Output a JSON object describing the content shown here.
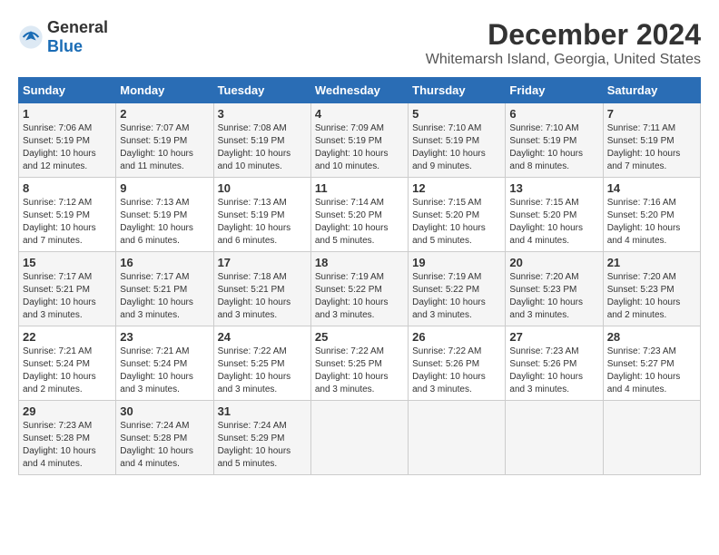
{
  "header": {
    "logo": {
      "general": "General",
      "blue": "Blue"
    },
    "title": "December 2024",
    "subtitle": "Whitemarsh Island, Georgia, United States"
  },
  "calendar": {
    "days_of_week": [
      "Sunday",
      "Monday",
      "Tuesday",
      "Wednesday",
      "Thursday",
      "Friday",
      "Saturday"
    ],
    "weeks": [
      [
        {
          "day": "1",
          "sunrise": "7:06 AM",
          "sunset": "5:19 PM",
          "daylight": "10 hours and 12 minutes."
        },
        {
          "day": "2",
          "sunrise": "7:07 AM",
          "sunset": "5:19 PM",
          "daylight": "10 hours and 11 minutes."
        },
        {
          "day": "3",
          "sunrise": "7:08 AM",
          "sunset": "5:19 PM",
          "daylight": "10 hours and 10 minutes."
        },
        {
          "day": "4",
          "sunrise": "7:09 AM",
          "sunset": "5:19 PM",
          "daylight": "10 hours and 10 minutes."
        },
        {
          "day": "5",
          "sunrise": "7:10 AM",
          "sunset": "5:19 PM",
          "daylight": "10 hours and 9 minutes."
        },
        {
          "day": "6",
          "sunrise": "7:10 AM",
          "sunset": "5:19 PM",
          "daylight": "10 hours and 8 minutes."
        },
        {
          "day": "7",
          "sunrise": "7:11 AM",
          "sunset": "5:19 PM",
          "daylight": "10 hours and 7 minutes."
        }
      ],
      [
        {
          "day": "8",
          "sunrise": "7:12 AM",
          "sunset": "5:19 PM",
          "daylight": "10 hours and 7 minutes."
        },
        {
          "day": "9",
          "sunrise": "7:13 AM",
          "sunset": "5:19 PM",
          "daylight": "10 hours and 6 minutes."
        },
        {
          "day": "10",
          "sunrise": "7:13 AM",
          "sunset": "5:19 PM",
          "daylight": "10 hours and 6 minutes."
        },
        {
          "day": "11",
          "sunrise": "7:14 AM",
          "sunset": "5:20 PM",
          "daylight": "10 hours and 5 minutes."
        },
        {
          "day": "12",
          "sunrise": "7:15 AM",
          "sunset": "5:20 PM",
          "daylight": "10 hours and 5 minutes."
        },
        {
          "day": "13",
          "sunrise": "7:15 AM",
          "sunset": "5:20 PM",
          "daylight": "10 hours and 4 minutes."
        },
        {
          "day": "14",
          "sunrise": "7:16 AM",
          "sunset": "5:20 PM",
          "daylight": "10 hours and 4 minutes."
        }
      ],
      [
        {
          "day": "15",
          "sunrise": "7:17 AM",
          "sunset": "5:21 PM",
          "daylight": "10 hours and 3 minutes."
        },
        {
          "day": "16",
          "sunrise": "7:17 AM",
          "sunset": "5:21 PM",
          "daylight": "10 hours and 3 minutes."
        },
        {
          "day": "17",
          "sunrise": "7:18 AM",
          "sunset": "5:21 PM",
          "daylight": "10 hours and 3 minutes."
        },
        {
          "day": "18",
          "sunrise": "7:19 AM",
          "sunset": "5:22 PM",
          "daylight": "10 hours and 3 minutes."
        },
        {
          "day": "19",
          "sunrise": "7:19 AM",
          "sunset": "5:22 PM",
          "daylight": "10 hours and 3 minutes."
        },
        {
          "day": "20",
          "sunrise": "7:20 AM",
          "sunset": "5:23 PM",
          "daylight": "10 hours and 3 minutes."
        },
        {
          "day": "21",
          "sunrise": "7:20 AM",
          "sunset": "5:23 PM",
          "daylight": "10 hours and 2 minutes."
        }
      ],
      [
        {
          "day": "22",
          "sunrise": "7:21 AM",
          "sunset": "5:24 PM",
          "daylight": "10 hours and 2 minutes."
        },
        {
          "day": "23",
          "sunrise": "7:21 AM",
          "sunset": "5:24 PM",
          "daylight": "10 hours and 3 minutes."
        },
        {
          "day": "24",
          "sunrise": "7:22 AM",
          "sunset": "5:25 PM",
          "daylight": "10 hours and 3 minutes."
        },
        {
          "day": "25",
          "sunrise": "7:22 AM",
          "sunset": "5:25 PM",
          "daylight": "10 hours and 3 minutes."
        },
        {
          "day": "26",
          "sunrise": "7:22 AM",
          "sunset": "5:26 PM",
          "daylight": "10 hours and 3 minutes."
        },
        {
          "day": "27",
          "sunrise": "7:23 AM",
          "sunset": "5:26 PM",
          "daylight": "10 hours and 3 minutes."
        },
        {
          "day": "28",
          "sunrise": "7:23 AM",
          "sunset": "5:27 PM",
          "daylight": "10 hours and 4 minutes."
        }
      ],
      [
        {
          "day": "29",
          "sunrise": "7:23 AM",
          "sunset": "5:28 PM",
          "daylight": "10 hours and 4 minutes."
        },
        {
          "day": "30",
          "sunrise": "7:24 AM",
          "sunset": "5:28 PM",
          "daylight": "10 hours and 4 minutes."
        },
        {
          "day": "31",
          "sunrise": "7:24 AM",
          "sunset": "5:29 PM",
          "daylight": "10 hours and 5 minutes."
        },
        null,
        null,
        null,
        null
      ]
    ]
  }
}
